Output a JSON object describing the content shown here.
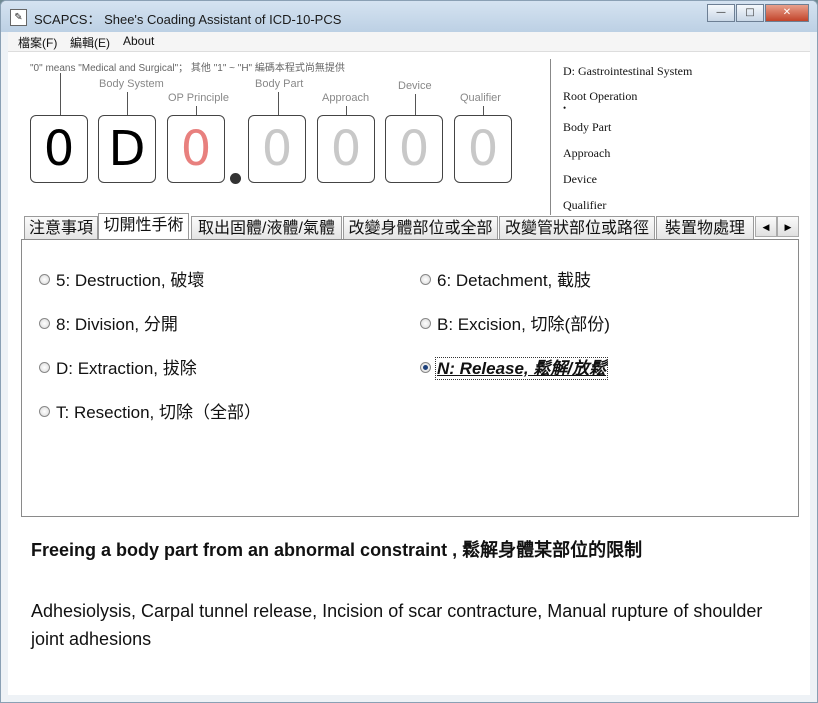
{
  "window": {
    "title": "SCAPCS： Shee's Coading Assistant of ICD-10-PCS",
    "minimize": "—",
    "maximize": "□",
    "close": "✕"
  },
  "menu": {
    "file": "檔案(F)",
    "edit": "編輯(E)",
    "about": "About"
  },
  "code_header": {
    "hint": "\"0\" means \"Medical and Surgical\"； 其他 \"1\" ~ \"H\" 編碼本程式尚無提供",
    "labels": {
      "body_system": "Body System",
      "op_principle": "OP Principle",
      "body_part": "Body Part",
      "approach": "Approach",
      "device": "Device",
      "qualifier": "Qualifier"
    },
    "digits": [
      "0",
      "D",
      "0",
      "0",
      "0",
      "0",
      "0"
    ],
    "digit_colors": [
      "#000000",
      "#000000",
      "#e8807e",
      "#c8c8c8",
      "#c8c8c8",
      "#c8c8c8",
      "#c8c8c8"
    ]
  },
  "info_panel": {
    "body_system": "D: Gastrointestinal System",
    "root_operation": "Root Operation",
    "bullet": "•",
    "body_part": "Body Part",
    "approach": "Approach",
    "device": "Device",
    "qualifier": "Qualifier"
  },
  "tabs": [
    "注意事項",
    "切開性手術",
    "取出固體/液體/氣體",
    "改變身體部位或全部",
    "改變管狀部位或路徑",
    "裝置物處理"
  ],
  "active_tab_index": 1,
  "tab_scroll": {
    "left": "◀",
    "right": "▶"
  },
  "options": [
    {
      "label": "5: Destruction, 破壞",
      "selected": false
    },
    {
      "label": "6: Detachment, 截肢",
      "selected": false
    },
    {
      "label": "8: Division, 分開",
      "selected": false
    },
    {
      "label": "B: Excision, 切除(部份)",
      "selected": false
    },
    {
      "label": "D: Extraction, 拔除",
      "selected": false
    },
    {
      "label": "N: Release, 鬆解/放鬆",
      "selected": true
    },
    {
      "label": "T: Resection, 切除（全部）",
      "selected": false
    }
  ],
  "definition": "Freeing a body part from an abnormal constraint , 鬆解身體某部位的限制",
  "examples": "Adhesiolysis, Carpal tunnel release, Incision of scar contracture, Manual rupture of shoulder joint adhesions"
}
